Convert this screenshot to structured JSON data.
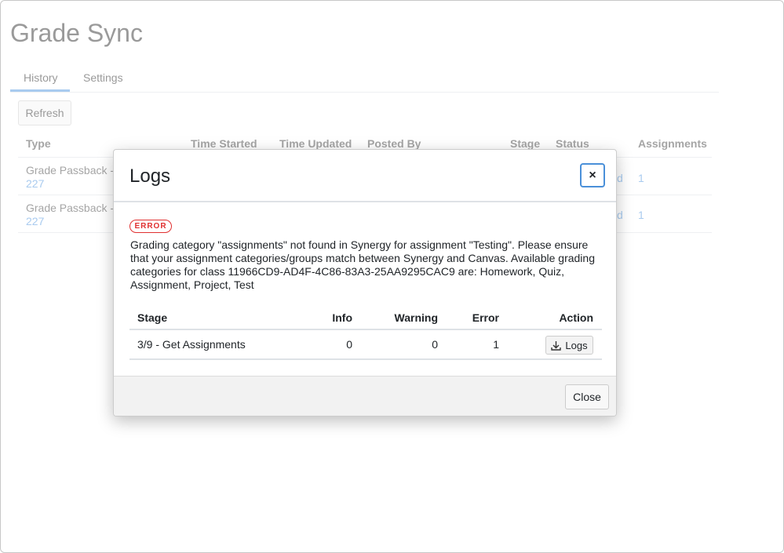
{
  "page": {
    "title": "Grade Sync",
    "tabs": [
      {
        "label": "History"
      },
      {
        "label": "Settings"
      }
    ],
    "refresh_label": "Refresh",
    "columns": [
      "Type",
      "Time Started",
      "Time Updated",
      "Posted By",
      "Stage",
      "Status",
      "Assignments"
    ],
    "rows": [
      {
        "type": "Grade Passback -",
        "id": "227",
        "status": "d",
        "assignments": "1"
      },
      {
        "type": "Grade Passback -",
        "id": "227",
        "status": "d",
        "assignments": "1"
      }
    ]
  },
  "modal": {
    "title": "Logs",
    "close_icon": "×",
    "badge": "ERROR",
    "message": "Grading category \"assignments\" not found in Synergy for assignment \"Testing\". Please ensure that your assignment categories/groups match between Synergy and Canvas. Available grading categories for class 11966CD9-AD4F-4C86-83A3-25AA9295CAC9 are: Homework, Quiz, Assignment, Project, Test",
    "table": {
      "headers": [
        "Stage",
        "Info",
        "Warning",
        "Error",
        "Action"
      ],
      "rows": [
        {
          "stage": "3/9 - Get Assignments",
          "info": "0",
          "warning": "0",
          "error": "1",
          "action": "Logs"
        }
      ]
    },
    "close_label": "Close"
  }
}
